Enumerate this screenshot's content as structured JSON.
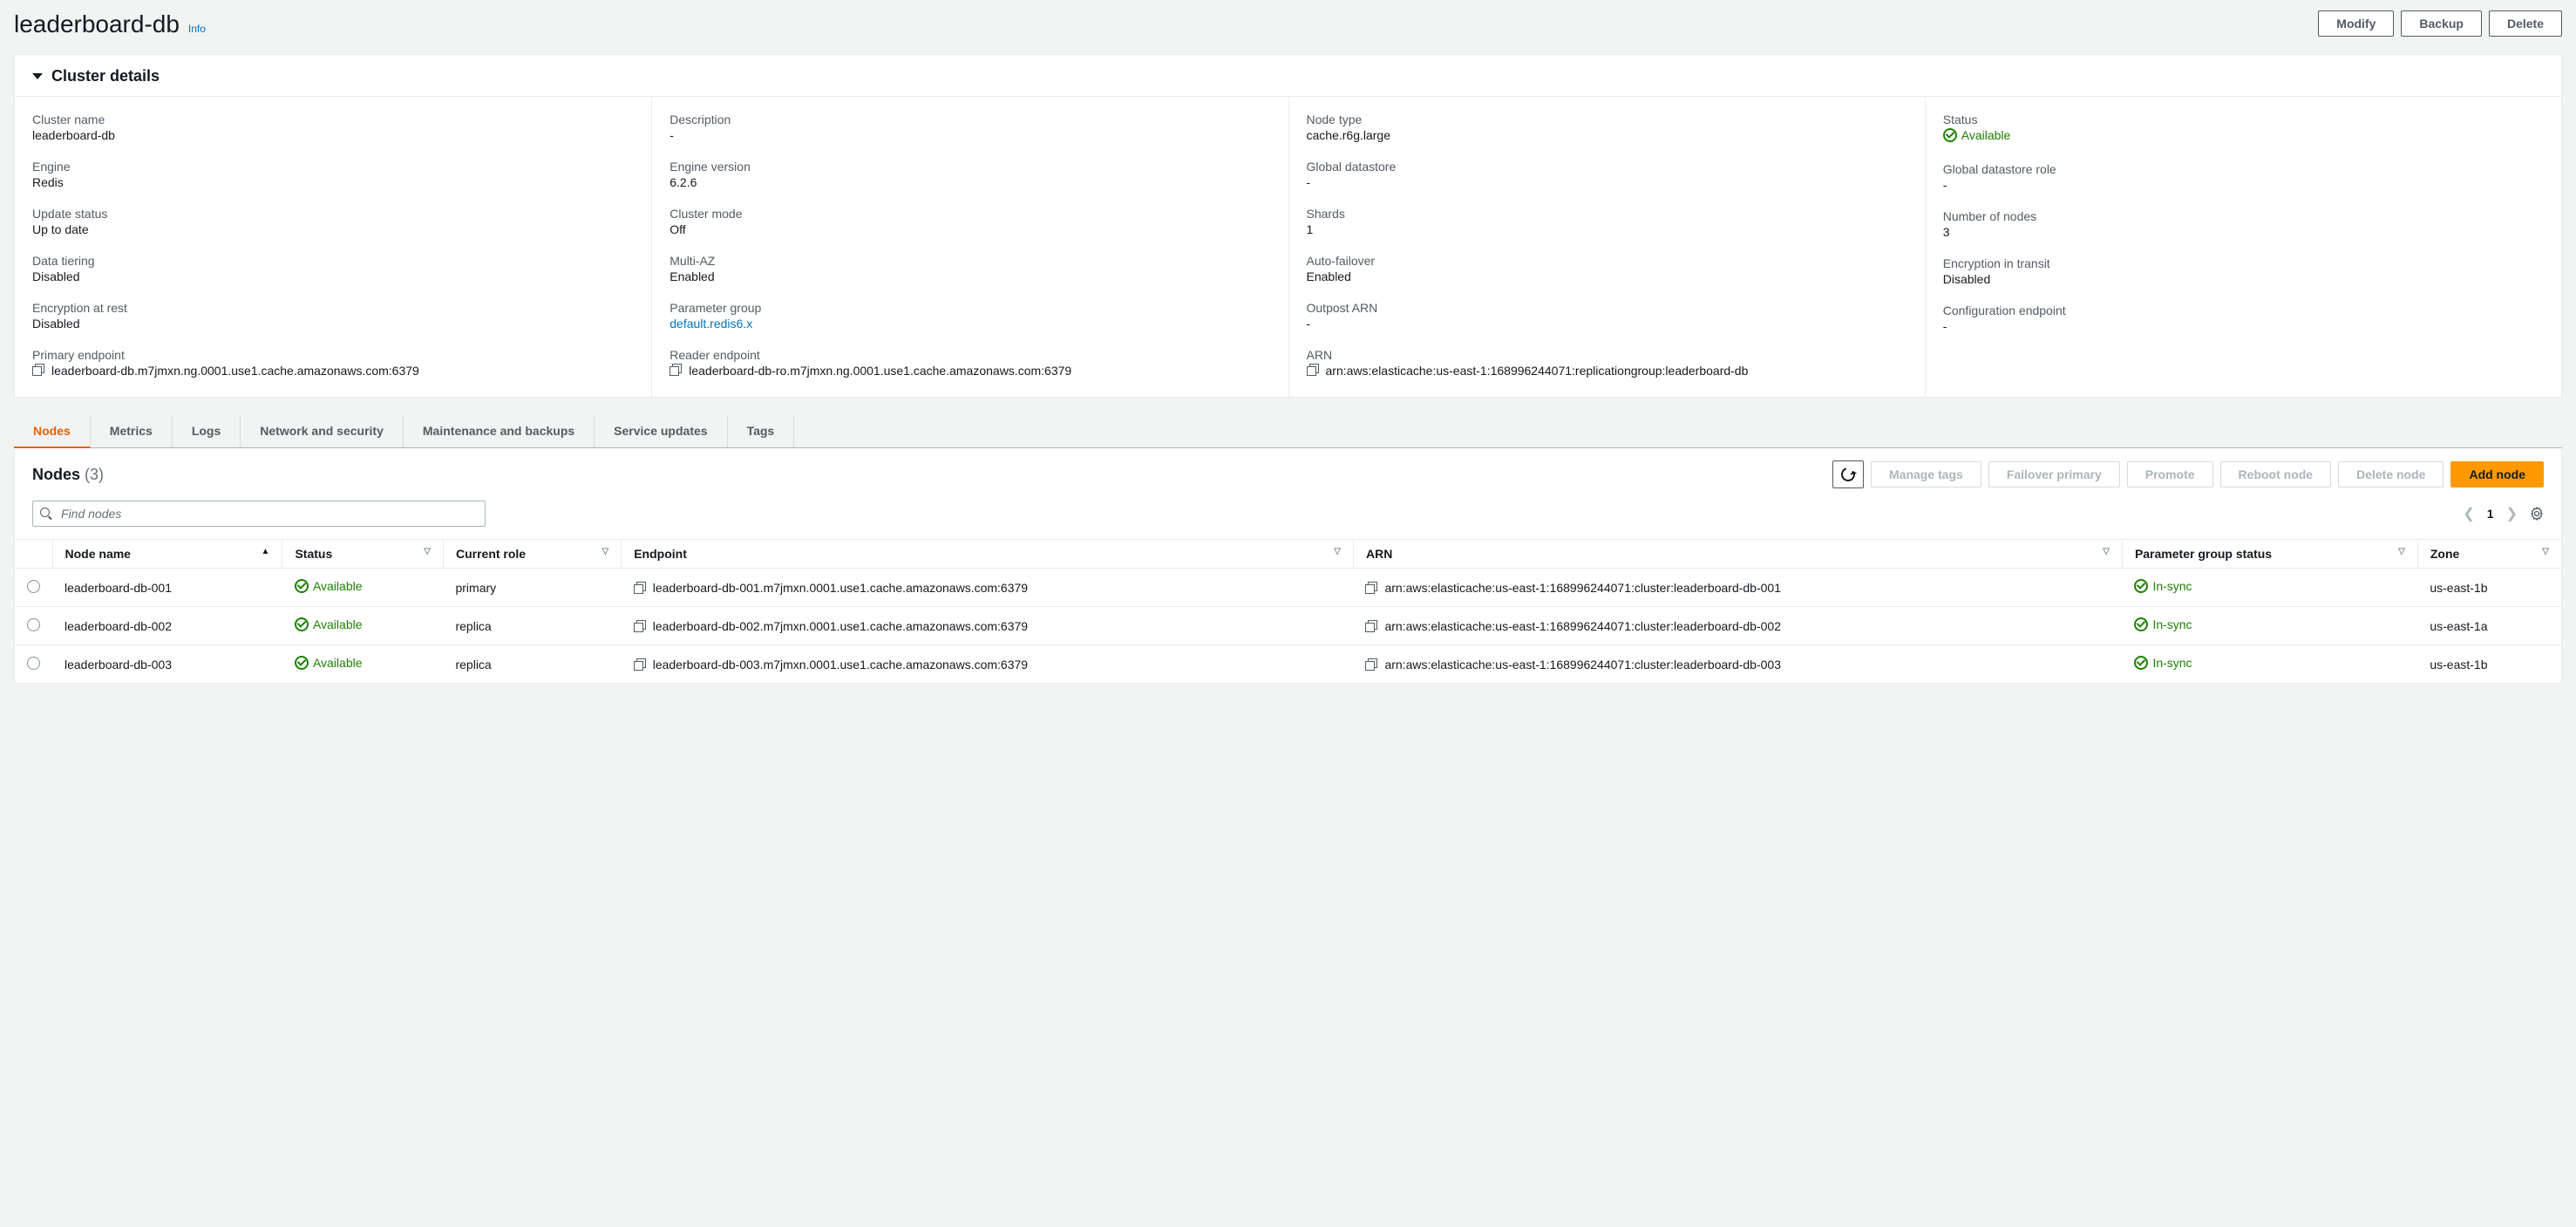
{
  "header": {
    "title": "leaderboard-db",
    "info_label": "Info",
    "modify": "Modify",
    "backup": "Backup",
    "delete": "Delete"
  },
  "details": {
    "title": "Cluster details",
    "columns": [
      [
        {
          "label": "Cluster name",
          "value": "leaderboard-db"
        },
        {
          "label": "Engine",
          "value": "Redis"
        },
        {
          "label": "Update status",
          "value": "Up to date"
        },
        {
          "label": "Data tiering",
          "value": "Disabled"
        },
        {
          "label": "Encryption at rest",
          "value": "Disabled"
        },
        {
          "label": "Primary endpoint",
          "value": "leaderboard-db.m7jmxn.ng.0001.use1.cache.amazonaws.com:6379",
          "copy": true
        }
      ],
      [
        {
          "label": "Description",
          "value": "-"
        },
        {
          "label": "Engine version",
          "value": "6.2.6"
        },
        {
          "label": "Cluster mode",
          "value": "Off"
        },
        {
          "label": "Multi-AZ",
          "value": "Enabled"
        },
        {
          "label": "Parameter group",
          "value": "default.redis6.x",
          "link": true
        },
        {
          "label": "Reader endpoint",
          "value": "leaderboard-db-ro.m7jmxn.ng.0001.use1.cache.amazonaws.com:6379",
          "copy": true
        }
      ],
      [
        {
          "label": "Node type",
          "value": "cache.r6g.large"
        },
        {
          "label": "Global datastore",
          "value": "-"
        },
        {
          "label": "Shards",
          "value": "1"
        },
        {
          "label": "Auto-failover",
          "value": "Enabled"
        },
        {
          "label": "Outpost ARN",
          "value": "-"
        },
        {
          "label": "ARN",
          "value": "arn:aws:elasticache:us-east-1:168996244071:replicationgroup:leaderboard-db",
          "copy": true
        }
      ],
      [
        {
          "label": "Status",
          "value": "Available",
          "status": true
        },
        {
          "label": "Global datastore role",
          "value": "-"
        },
        {
          "label": "Number of nodes",
          "value": "3"
        },
        {
          "label": "Encryption in transit",
          "value": "Disabled"
        },
        {
          "label": "Configuration endpoint",
          "value": "-"
        }
      ]
    ]
  },
  "tabs": [
    "Nodes",
    "Metrics",
    "Logs",
    "Network and security",
    "Maintenance and backups",
    "Service updates",
    "Tags"
  ],
  "nodes": {
    "title": "Nodes",
    "count": "(3)",
    "actions": {
      "manage_tags": "Manage tags",
      "failover": "Failover primary",
      "promote": "Promote",
      "reboot": "Reboot node",
      "delete": "Delete node",
      "add": "Add node"
    },
    "search_placeholder": "Find nodes",
    "page": "1",
    "columns": [
      "Node name",
      "Status",
      "Current role",
      "Endpoint",
      "ARN",
      "Parameter group status",
      "Zone"
    ],
    "rows": [
      {
        "name": "leaderboard-db-001",
        "status": "Available",
        "role": "primary",
        "endpoint": "leaderboard-db-001.m7jmxn.0001.use1.cache.amazonaws.com:6379",
        "arn": "arn:aws:elasticache:us-east-1:168996244071:cluster:leaderboard-db-001",
        "pg": "In-sync",
        "zone": "us-east-1b"
      },
      {
        "name": "leaderboard-db-002",
        "status": "Available",
        "role": "replica",
        "endpoint": "leaderboard-db-002.m7jmxn.0001.use1.cache.amazonaws.com:6379",
        "arn": "arn:aws:elasticache:us-east-1:168996244071:cluster:leaderboard-db-002",
        "pg": "In-sync",
        "zone": "us-east-1a"
      },
      {
        "name": "leaderboard-db-003",
        "status": "Available",
        "role": "replica",
        "endpoint": "leaderboard-db-003.m7jmxn.0001.use1.cache.amazonaws.com:6379",
        "arn": "arn:aws:elasticache:us-east-1:168996244071:cluster:leaderboard-db-003",
        "pg": "In-sync",
        "zone": "us-east-1b"
      }
    ]
  }
}
